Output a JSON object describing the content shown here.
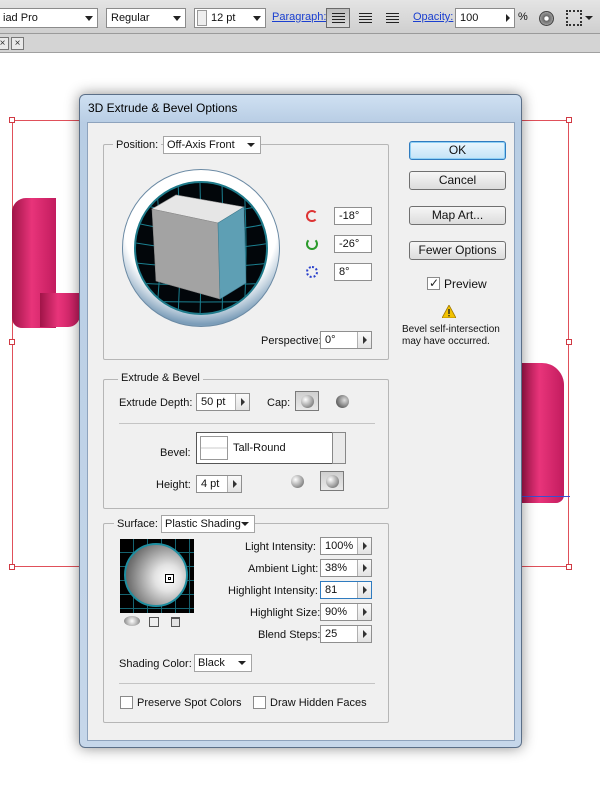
{
  "toolbar": {
    "font_family": "iad Pro",
    "font_style": "Regular",
    "font_size": "12 pt",
    "paragraph_link": "Paragraph:",
    "opacity_link": "Opacity:",
    "opacity_value": "100",
    "opacity_unit": "%"
  },
  "tab": {
    "close_glyph": "×"
  },
  "colors": {
    "accent": "#2f7bbf",
    "artwork": "#e8347a",
    "selection": "#e0505a"
  },
  "dialog": {
    "title": "3D Extrude & Bevel Options",
    "position": {
      "label": "Position:",
      "value": "Off-Axis Front",
      "rotate_x": "-18°",
      "rotate_y": "-26°",
      "rotate_z": "8°",
      "perspective_label": "Perspective:",
      "perspective_value": "0°"
    },
    "buttons": {
      "ok": "OK",
      "cancel": "Cancel",
      "map_art": "Map Art...",
      "fewer_options": "Fewer Options"
    },
    "preview": {
      "label": "Preview",
      "checked": true
    },
    "warning": "Bevel self-intersection may have occurred.",
    "extrude": {
      "group_label": "Extrude & Bevel",
      "depth_label": "Extrude Depth:",
      "depth_value": "50 pt",
      "cap_label": "Cap:",
      "bevel_label": "Bevel:",
      "bevel_value": "Tall-Round",
      "height_label": "Height:",
      "height_value": "4 pt"
    },
    "surface": {
      "label": "Surface:",
      "value": "Plastic Shading",
      "light_intensity_label": "Light Intensity:",
      "light_intensity_value": "100%",
      "ambient_light_label": "Ambient Light:",
      "ambient_light_value": "38%",
      "highlight_intensity_label": "Highlight Intensity:",
      "highlight_intensity_value": "81",
      "highlight_size_label": "Highlight Size:",
      "highlight_size_value": "90%",
      "blend_steps_label": "Blend Steps:",
      "blend_steps_value": "25",
      "shading_color_label": "Shading Color:",
      "shading_color_value": "Black"
    },
    "options": {
      "preserve_spot": "Preserve Spot Colors",
      "draw_hidden": "Draw Hidden Faces"
    }
  }
}
